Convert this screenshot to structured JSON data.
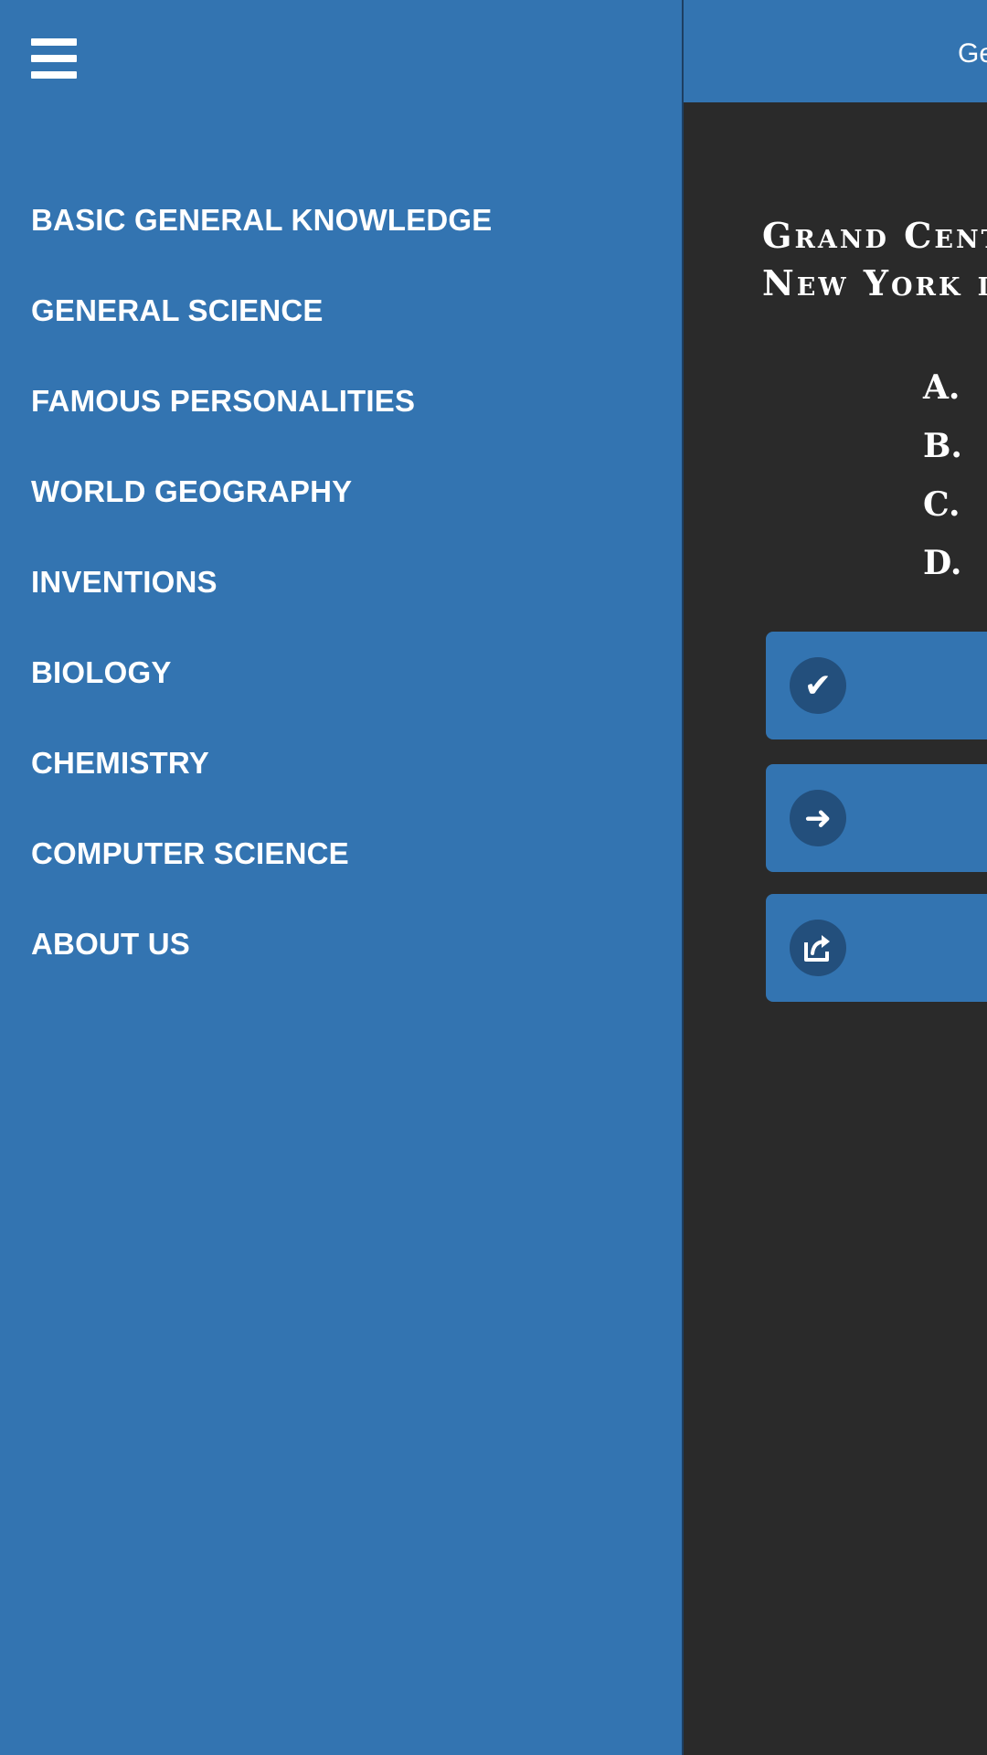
{
  "sidebar": {
    "menu_icon": "hamburger-menu-icon",
    "items": [
      {
        "label": "BASIC GENERAL KNOWLEDGE"
      },
      {
        "label": "GENERAL SCIENCE"
      },
      {
        "label": "FAMOUS PERSONALITIES"
      },
      {
        "label": "WORLD GEOGRAPHY"
      },
      {
        "label": "INVENTIONS"
      },
      {
        "label": "BIOLOGY"
      },
      {
        "label": "CHEMISTRY"
      },
      {
        "label": "COMPUTER SCIENCE"
      },
      {
        "label": "ABOUT US"
      }
    ]
  },
  "main": {
    "header_title": "Ge",
    "question_line1": "Grand Cent",
    "question_line2": "New York is",
    "options": [
      {
        "letter": "A."
      },
      {
        "letter": "B."
      },
      {
        "letter": "C."
      },
      {
        "letter": "D."
      }
    ],
    "actions": [
      {
        "icon": "check-circle-icon"
      },
      {
        "icon": "arrow-right-circle-icon"
      },
      {
        "icon": "share-icon"
      }
    ]
  },
  "colors": {
    "sidebar_bg": "#3374b1",
    "main_bg": "#2a2a2a",
    "icon_circle": "#234f7c",
    "text": "#ffffff"
  }
}
